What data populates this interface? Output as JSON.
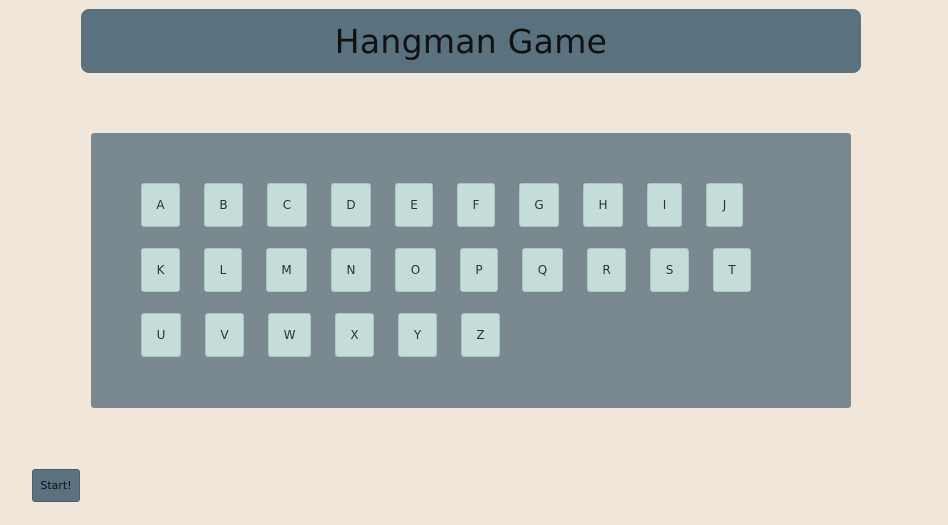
{
  "title": "Hangman Game",
  "keyboard": {
    "rows": [
      [
        "A",
        "B",
        "C",
        "D",
        "E",
        "F",
        "G",
        "H",
        "I",
        "J"
      ],
      [
        "K",
        "L",
        "M",
        "N",
        "O",
        "P",
        "Q",
        "R",
        "S",
        "T"
      ],
      [
        "U",
        "V",
        "W",
        "X",
        "Y",
        "Z"
      ]
    ]
  },
  "start_button": "Start!",
  "colors": {
    "background": "#f1e6da",
    "title_bar": "#5a717f",
    "keyboard_panel": "#79898f",
    "key": "#c5ddd9"
  }
}
